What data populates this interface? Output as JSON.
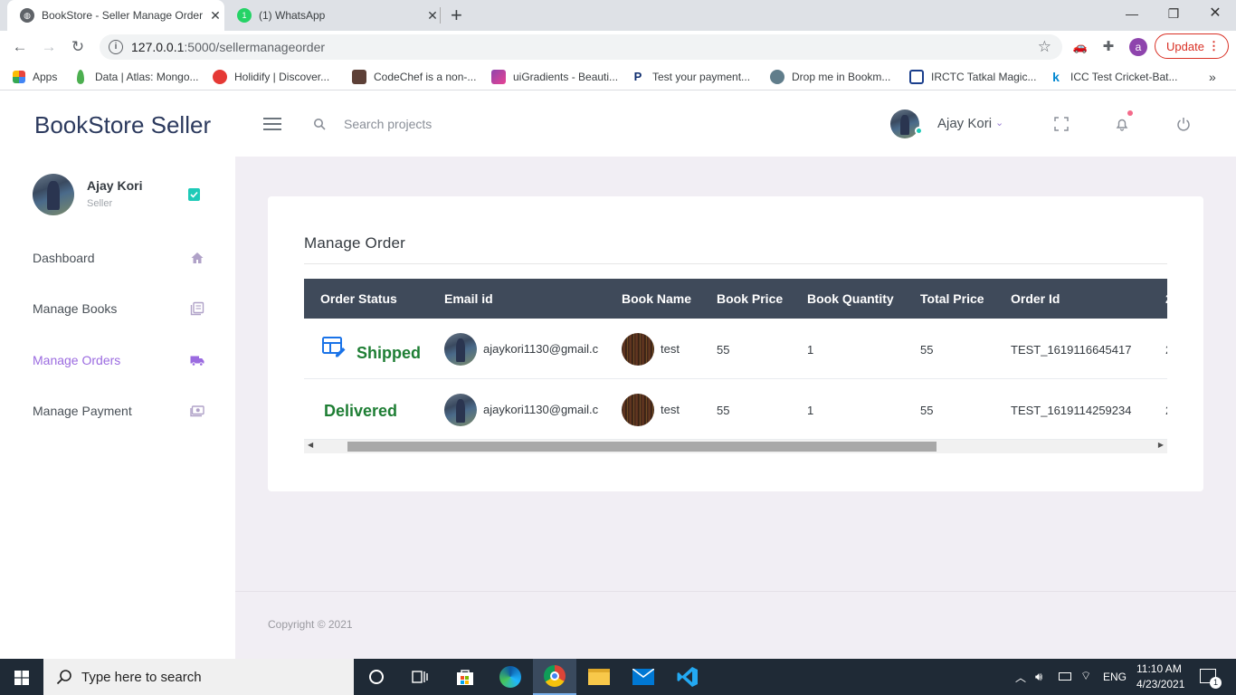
{
  "browser": {
    "tabs": [
      {
        "title": "BookStore - Seller Manage Order",
        "active": true
      },
      {
        "title": "(1) WhatsApp",
        "active": false
      }
    ],
    "new_tab": "+",
    "url_host": "127.0.0.1",
    "url_path": ":5000/sellermanageorder",
    "profile_initial": "a",
    "update_label": "Update",
    "bookmarks": [
      {
        "label": "Apps",
        "color": "#e8453c"
      },
      {
        "label": "Data | Atlas: Mongo...",
        "color": "#4caf50"
      },
      {
        "label": "Holidify | Discover...",
        "color": "#e53935"
      },
      {
        "label": "CodeChef is a non-...",
        "color": "#5d4037"
      },
      {
        "label": "uiGradients - Beauti...",
        "color": "#8e44ad"
      },
      {
        "label": "Test your payment...",
        "color": "#0d2c6e"
      },
      {
        "label": "Drop me in Bookm...",
        "color": "#607d8b"
      },
      {
        "label": "IRCTC Tatkal Magic...",
        "color": "#1a3e8c"
      },
      {
        "label": "ICC Test Cricket-Bat...",
        "color": "#0288d1"
      }
    ],
    "bookmarks_more": "»"
  },
  "app": {
    "brand": "BookStore Seller",
    "search_placeholder": "Search projects",
    "user_name": "Ajay Kori",
    "user_role": "Seller",
    "accent": "#9b6be0"
  },
  "sidebar": {
    "items": [
      {
        "label": "Dashboard",
        "icon": "home-icon",
        "active": false
      },
      {
        "label": "Manage Books",
        "icon": "books-icon",
        "active": false
      },
      {
        "label": "Manage Orders",
        "icon": "truck-icon",
        "active": true
      },
      {
        "label": "Manage Payment",
        "icon": "payment-icon",
        "active": false
      }
    ]
  },
  "main": {
    "title": "Manage Order",
    "columns": [
      "Order Status",
      "Email id",
      "Book Name",
      "Book Price",
      "Book Quantity",
      "Total Price",
      "Order Id",
      "2"
    ],
    "rows": [
      {
        "status": "Shipped",
        "status_icon": "edit-status-icon",
        "email": "ajaykori1130@gmail.c",
        "book": "test",
        "price": "55",
        "quantity": "1",
        "total": "55",
        "order_id": "TEST_1619116645417",
        "extra": "2"
      },
      {
        "status": "Delivered",
        "status_icon": "",
        "email": "ajaykori1130@gmail.c",
        "book": "test",
        "price": "55",
        "quantity": "1",
        "total": "55",
        "order_id": "TEST_1619114259234",
        "extra": "2"
      }
    ],
    "scroll_left": "◀",
    "scroll_right": "▶",
    "copyright": "Copyright © 2021"
  },
  "taskbar": {
    "search_placeholder": "Type here to search",
    "language": "ENG",
    "time": "11:10 AM",
    "date": "4/23/2021",
    "notification_count": "1"
  }
}
